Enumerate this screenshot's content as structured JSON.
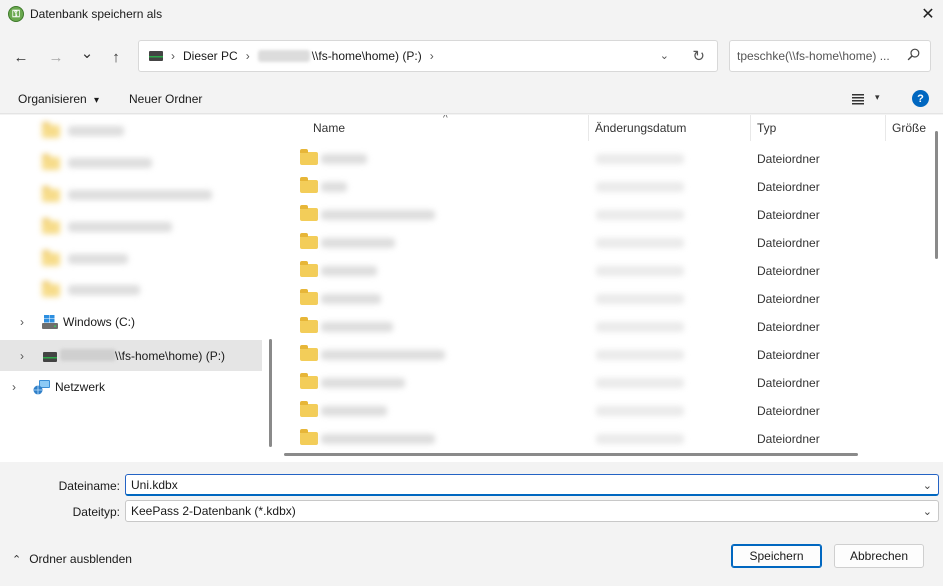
{
  "window": {
    "title": "Datenbank speichern als",
    "close_glyph": "✕"
  },
  "navigation": {
    "back_glyph": "←",
    "forward_glyph": "→",
    "recent_glyph": "⌄",
    "up_glyph": "↑",
    "address": {
      "segments": [
        "Dieser PC",
        "\\\\fs-home\\home) (P:)"
      ],
      "separator": "›",
      "dropdown_glyph": "⌄",
      "refresh_glyph": "↻"
    },
    "search": {
      "placeholder": "tpeschke(\\\\fs-home\\home) ..."
    }
  },
  "toolbar": {
    "organize_label": "Organisieren",
    "organize_caret": "▾",
    "new_folder_label": "Neuer Ordner",
    "view_caret": "▾",
    "help_glyph": "?"
  },
  "sidebar": {
    "items": [
      {
        "label": "Windows (C:)",
        "icon": "windows-drive-icon"
      },
      {
        "label": "\\\\fs-home\\home) (P:)",
        "icon": "network-drive-icon",
        "selected": true
      },
      {
        "label": "Netzwerk",
        "icon": "network-icon"
      }
    ],
    "expand_glyph": "›"
  },
  "file_list": {
    "columns": {
      "name": "Name",
      "date": "Änderungsdatum",
      "type": "Typ",
      "size": "Größe"
    },
    "sort_glyph": "^",
    "rows": [
      {
        "type": "Dateiordner"
      },
      {
        "type": "Dateiordner"
      },
      {
        "type": "Dateiordner"
      },
      {
        "type": "Dateiordner"
      },
      {
        "type": "Dateiordner"
      },
      {
        "type": "Dateiordner"
      },
      {
        "type": "Dateiordner"
      },
      {
        "type": "Dateiordner"
      },
      {
        "type": "Dateiordner"
      },
      {
        "type": "Dateiordner"
      },
      {
        "type": "Dateiordner"
      }
    ]
  },
  "form": {
    "filename_label": "Dateiname:",
    "filename_value": "Uni.kdbx",
    "filetype_label": "Dateityp:",
    "filetype_value": "KeePass 2-Datenbank (*.kdbx)",
    "dropdown_glyph": "⌄"
  },
  "footer": {
    "hide_folders_label": "Ordner ausblenden",
    "hide_folders_glyph": "⌃",
    "save_label": "Speichern",
    "cancel_label": "Abbrechen"
  },
  "colors": {
    "accent": "#0067c0",
    "folder": "#f3cd59",
    "background": "#f3f3f3"
  }
}
